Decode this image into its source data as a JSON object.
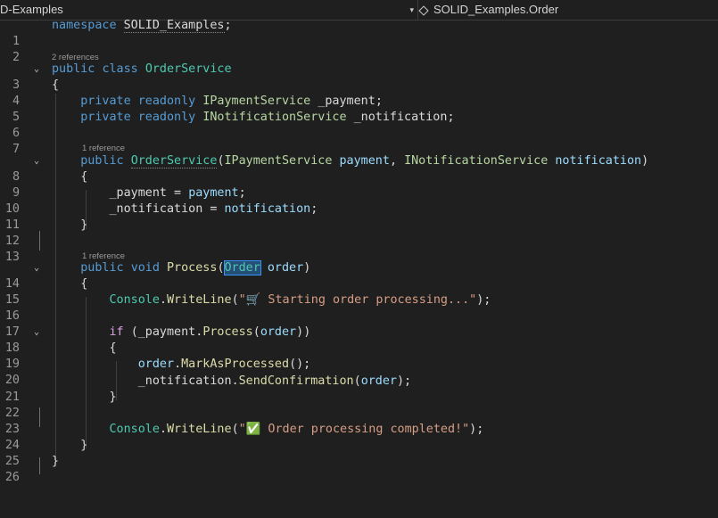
{
  "nav": {
    "project": "D-Examples",
    "member": "SOLID_Examples.Order",
    "dropdown_glyph": "▾"
  },
  "code_lens": {
    "l2": "2 references",
    "l7": "1 reference",
    "l13": "1 reference"
  },
  "line_numbers": [
    "1",
    "2",
    "3",
    "4",
    "5",
    "6",
    "7",
    "8",
    "9",
    "10",
    "11",
    "12",
    "13",
    "14",
    "15",
    "16",
    "17",
    "18",
    "19",
    "20",
    "21",
    "22",
    "23",
    "24",
    "25",
    "26"
  ],
  "tokens": {
    "namespace": "namespace",
    "ns_name": "SOLID_Examples",
    "semi": ";",
    "public": "public",
    "class": "class",
    "class_name": "OrderService",
    "lbrace": "{",
    "rbrace": "}",
    "private": "private",
    "readonly": "readonly",
    "ipay": "IPaymentService",
    "inot": "INotificationService",
    "f_pay": "_payment",
    "f_not": "_notification",
    "p_pay": "payment",
    "p_not": "notification",
    "void": "void",
    "process": "Process",
    "order_type": "Order",
    "order_param": "order",
    "console": "Console",
    "writeline": "WriteLine",
    "if": "if",
    "mark": "MarkAsProcessed",
    "send": "SendConfirmation",
    "str1": "\"🛒 Starting order processing...\"",
    "str2": "\"✅ Order processing completed!\"",
    "eq": " = ",
    "comma": ", ",
    "lparen": "(",
    "rparen": ")",
    "dot": ".",
    "callend": "();",
    "closecall": ");"
  },
  "fold_glyph": "⌄"
}
